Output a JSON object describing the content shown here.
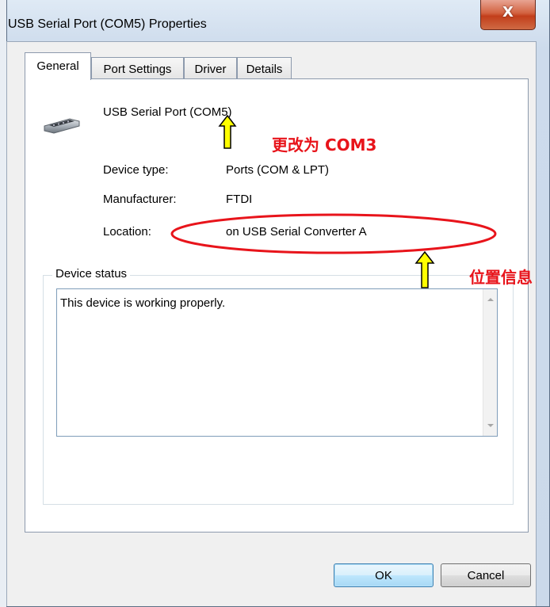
{
  "window": {
    "title": "USB Serial Port (COM5) Properties",
    "close_glyph": "X"
  },
  "tabs": [
    {
      "label": "General",
      "active": true
    },
    {
      "label": "Port Settings",
      "active": false
    },
    {
      "label": "Driver",
      "active": false
    },
    {
      "label": "Details",
      "active": false
    }
  ],
  "general": {
    "device_icon": "serial-port-connector-icon",
    "device_name": "USB Serial Port (COM5)",
    "rows": [
      {
        "label": "Device type:",
        "value": "Ports (COM & LPT)"
      },
      {
        "label": "Manufacturer:",
        "value": "FTDI"
      },
      {
        "label": "Location:",
        "value": "on USB Serial Converter A"
      }
    ],
    "device_status": {
      "label": "Device status",
      "text": "This device is working properly."
    }
  },
  "annotations": {
    "com_note": "更改为 COM3",
    "location_note": "位置信息",
    "arrow_color": "#ffff00",
    "mark_color": "#e8141b"
  },
  "buttons": {
    "ok": "OK",
    "cancel": "Cancel"
  }
}
